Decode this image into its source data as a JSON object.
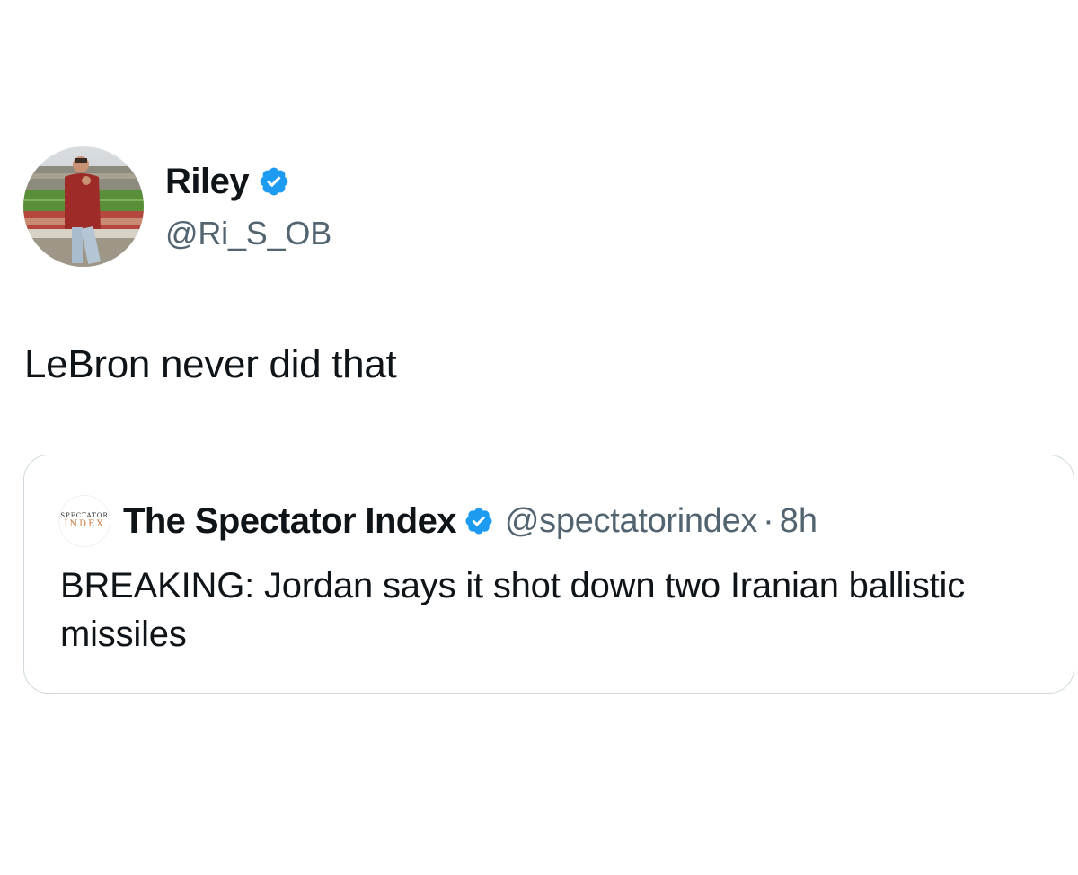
{
  "tweet": {
    "author": {
      "name": "Riley",
      "handle": "@Ri_S_OB",
      "verified": true,
      "avatar_icon": "person-in-stadium-photo"
    },
    "text": "LeBron never did that",
    "quote": {
      "author": {
        "name": "The Spectator Index",
        "handle": "@spectatorindex",
        "verified": true,
        "logo_top": "SPECTATOR",
        "logo_bottom": "INDEX"
      },
      "separator": "·",
      "time": "8h",
      "text": "BREAKING: Jordan says it shot down two Iranian ballistic missiles"
    }
  },
  "colors": {
    "verified": "#1d9bf0",
    "text": "#0f1419",
    "secondary": "#536471",
    "border": "#cfd9de"
  }
}
